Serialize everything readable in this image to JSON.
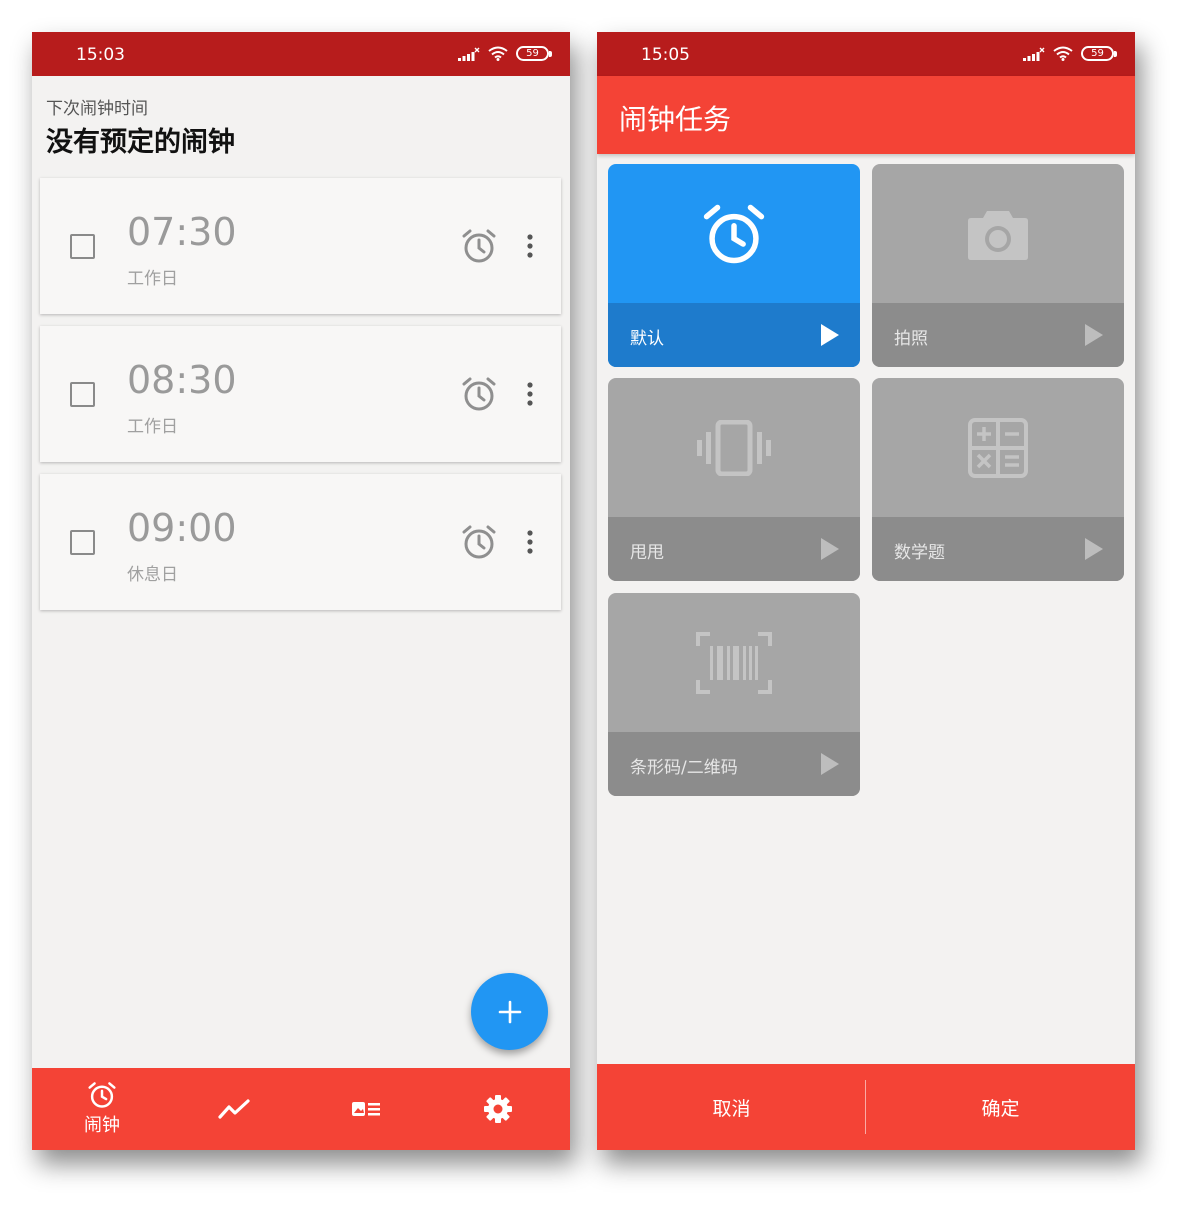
{
  "left_screen": {
    "status": {
      "time": "15:03",
      "battery": "59"
    },
    "next_alarm": {
      "label": "下次闹钟时间",
      "value": "没有预定的闹钟"
    },
    "alarms": [
      {
        "time": "07:30",
        "days": "工作日",
        "enabled": false
      },
      {
        "time": "08:30",
        "days": "工作日",
        "enabled": false
      },
      {
        "time": "09:00",
        "days": "休息日",
        "enabled": false
      }
    ],
    "bottom_nav": {
      "items": [
        {
          "icon": "alarm-clock-icon",
          "label": "闹钟",
          "selected": true
        },
        {
          "icon": "trend-chart-icon",
          "label": ""
        },
        {
          "icon": "image-list-icon",
          "label": ""
        },
        {
          "icon": "gear-icon",
          "label": ""
        }
      ]
    }
  },
  "right_screen": {
    "status": {
      "time": "15:05",
      "battery": "59"
    },
    "title": "闹钟任务",
    "tasks": [
      {
        "label": "默认",
        "icon": "alarm-clock-icon",
        "selected": true
      },
      {
        "label": "拍照",
        "icon": "camera-icon",
        "selected": false
      },
      {
        "label": "甩甩",
        "icon": "vibrate-phone-icon",
        "selected": false
      },
      {
        "label": "数学题",
        "icon": "calculator-icon",
        "selected": false
      },
      {
        "label": "条形码/二维码",
        "icon": "barcode-scan-icon",
        "selected": false
      }
    ],
    "actions": {
      "cancel": "取消",
      "confirm": "确定"
    }
  },
  "colors": {
    "status_bar": "#b71c1c",
    "primary": "#f44336",
    "accent_blue": "#2196f3",
    "tile_gray": "#a6a6a6",
    "tile_gray_dark": "#8c8c8c"
  }
}
